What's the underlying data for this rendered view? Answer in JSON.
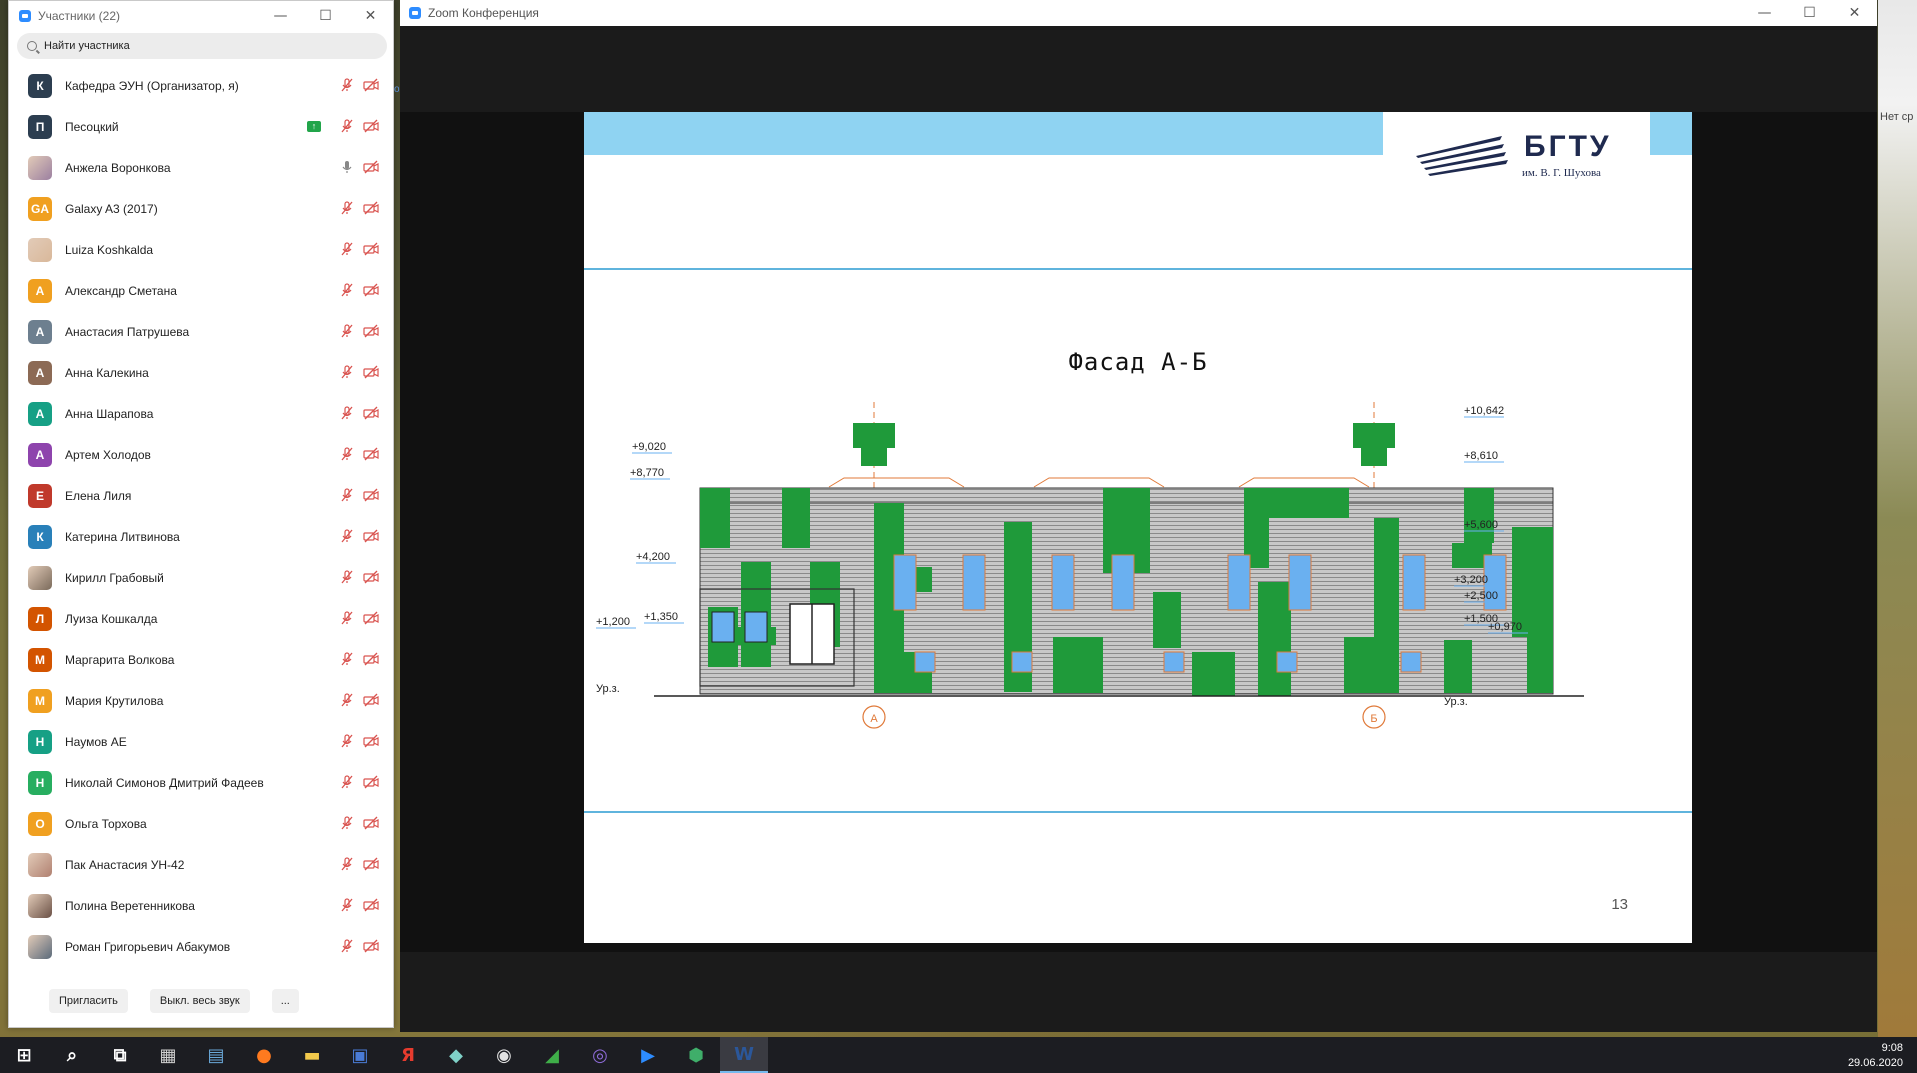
{
  "participants": {
    "title": "Участники (22)",
    "search_placeholder": "Найти участника",
    "list": [
      {
        "name": "Кафедра ЭУН (Организатор, я)",
        "initial": "К",
        "color": "#2c3e50",
        "photo": false,
        "share": false,
        "mic": "muted",
        "cam": "off"
      },
      {
        "name": "Песоцкий",
        "initial": "П",
        "color": "#2c3e50",
        "photo": false,
        "share": true,
        "mic": "muted",
        "cam": "off"
      },
      {
        "name": "Анжела Воронкова",
        "initial": "",
        "color": "#9b7fa0",
        "photo": true,
        "share": false,
        "mic": "on",
        "cam": "off"
      },
      {
        "name": "Galaxy A3 (2017)",
        "initial": "GA",
        "color": "#f0a020",
        "photo": false,
        "share": false,
        "mic": "muted",
        "cam": "off"
      },
      {
        "name": "Luiza Koshkalda",
        "initial": "",
        "color": "#d9b89a",
        "photo": true,
        "share": false,
        "mic": "muted",
        "cam": "off"
      },
      {
        "name": "Александр Сметана",
        "initial": "А",
        "color": "#f0a020",
        "photo": false,
        "share": false,
        "mic": "muted",
        "cam": "off"
      },
      {
        "name": "Анастасия Патрушева",
        "initial": "А",
        "color": "#6d7f8f",
        "photo": false,
        "share": false,
        "mic": "muted",
        "cam": "off"
      },
      {
        "name": "Анна Калекина",
        "initial": "А",
        "color": "#8c6a55",
        "photo": false,
        "share": false,
        "mic": "muted",
        "cam": "off"
      },
      {
        "name": "Анна Шарапова",
        "initial": "А",
        "color": "#16a085",
        "photo": false,
        "share": false,
        "mic": "muted",
        "cam": "off"
      },
      {
        "name": "Артем Холодов",
        "initial": "А",
        "color": "#8e44ad",
        "photo": false,
        "share": false,
        "mic": "muted",
        "cam": "off"
      },
      {
        "name": "Елена Лиля",
        "initial": "Е",
        "color": "#c0392b",
        "photo": false,
        "share": false,
        "mic": "muted",
        "cam": "off"
      },
      {
        "name": "Катерина Литвинова",
        "initial": "К",
        "color": "#2980b9",
        "photo": false,
        "share": false,
        "mic": "muted",
        "cam": "off"
      },
      {
        "name": "Кирилл Грабовый",
        "initial": "",
        "color": "#7a6a5a",
        "photo": true,
        "share": false,
        "mic": "muted",
        "cam": "off"
      },
      {
        "name": "Луиза Кошкалда",
        "initial": "Л",
        "color": "#d35400",
        "photo": false,
        "share": false,
        "mic": "muted",
        "cam": "off"
      },
      {
        "name": "Маргарита Волкова",
        "initial": "М",
        "color": "#d35400",
        "photo": false,
        "share": false,
        "mic": "muted",
        "cam": "off"
      },
      {
        "name": "Мария Крутилова",
        "initial": "М",
        "color": "#f0a020",
        "photo": false,
        "share": false,
        "mic": "muted",
        "cam": "off"
      },
      {
        "name": "Наумов АЕ",
        "initial": "Н",
        "color": "#16a085",
        "photo": false,
        "share": false,
        "mic": "muted",
        "cam": "off"
      },
      {
        "name": "Николай Симонов Дмитрий Фадеев",
        "initial": "Н",
        "color": "#27ae60",
        "photo": false,
        "share": false,
        "mic": "muted",
        "cam": "off"
      },
      {
        "name": "Ольга Торхова",
        "initial": "О",
        "color": "#f0a020",
        "photo": false,
        "share": false,
        "mic": "muted",
        "cam": "off"
      },
      {
        "name": "Пак Анастасия УН-42",
        "initial": "",
        "color": "#b08070",
        "photo": true,
        "share": false,
        "mic": "muted",
        "cam": "off"
      },
      {
        "name": "Полина Веретенникова",
        "initial": "",
        "color": "#6a5045",
        "photo": true,
        "share": false,
        "mic": "muted",
        "cam": "off"
      },
      {
        "name": "Роман Григорьевич Абакумов",
        "initial": "",
        "color": "#5a6a7a",
        "photo": true,
        "share": false,
        "mic": "muted",
        "cam": "off"
      }
    ],
    "footer": {
      "invite_label": "Пригласить",
      "mute_all_label": "Выкл. весь звук",
      "more_label": "..."
    }
  },
  "meeting": {
    "title": "Zoom Конференция",
    "edge_text": "о"
  },
  "slide": {
    "logo_text": "БГТУ",
    "logo_sub": "им. В. Г. Шухова",
    "title": "Фасад А-Б",
    "page_number": "13",
    "axis_a": "А",
    "axis_b": "Б",
    "ground_label": "Ур.з.",
    "elevations_left": [
      "+9,020",
      "+8,770",
      "+4,200",
      "+1,350",
      "+1,200"
    ],
    "elevations_right": [
      "+10,642",
      "+8,610",
      "+5,600",
      "+3,200",
      "+2,500",
      "+1,500",
      "+0,970"
    ]
  },
  "desktop": {
    "right_edge_text": "Нет ср"
  },
  "taskbar": {
    "time": "9:08",
    "date": "29.06.2020",
    "apps": [
      "start",
      "search",
      "task-view",
      "calculator",
      "word-pad",
      "firefox",
      "explorer",
      "save",
      "yandex",
      "notes",
      "paint",
      "excel-like",
      "viber",
      "zoom",
      "vpn",
      "word"
    ]
  },
  "colors": {
    "accent": "#2d8cff",
    "mute_red": "#d9534f",
    "slide_band": "#8fd3f2",
    "facade_green": "#1f9a3a",
    "window_blue": "#6ab0f0"
  }
}
